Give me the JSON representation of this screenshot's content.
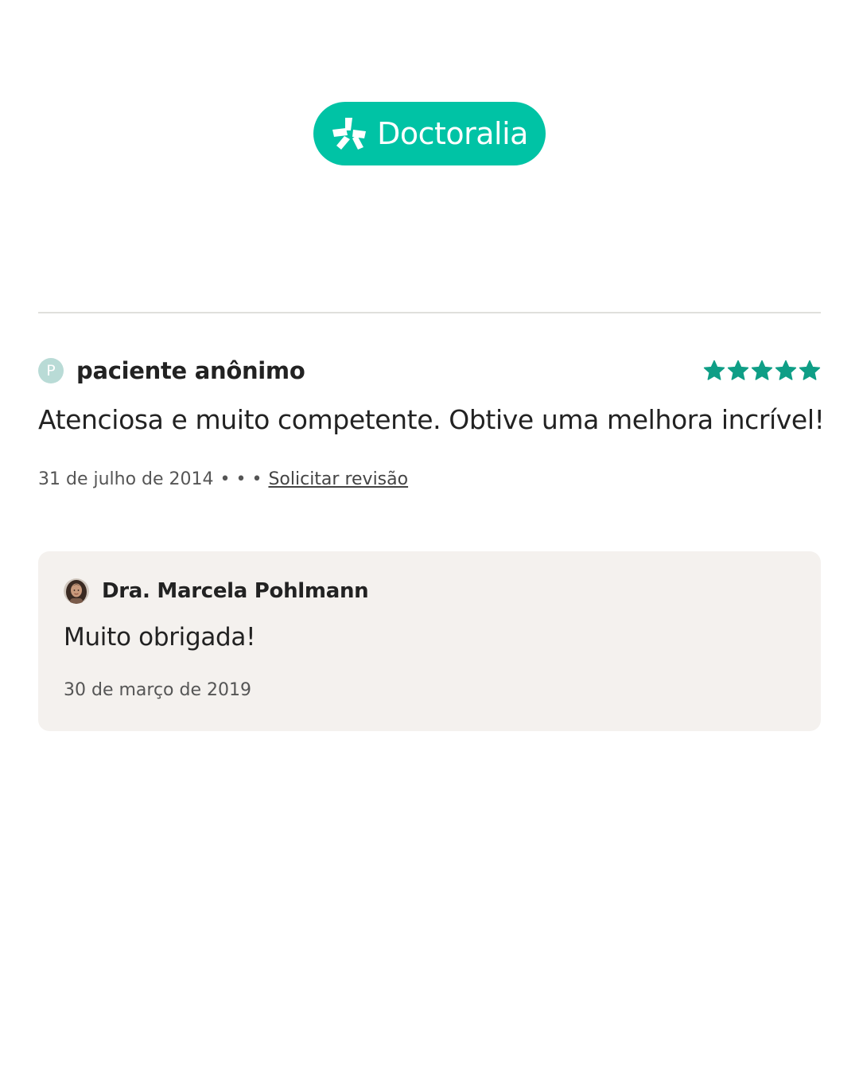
{
  "brand": {
    "name": "Doctoralia",
    "color": "#00c3a5",
    "logo_icon": "doctoralia-star-icon"
  },
  "review": {
    "author_initial": "P",
    "author_name": "paciente anônimo",
    "rating": 5,
    "rating_max": 5,
    "star_color": "#0f9e86",
    "text": "Atenciosa e muito competente. Obtive uma melhora incrível!",
    "date": "31 de julho de 2014",
    "separator": "• • •",
    "report_label": "Solicitar revisão"
  },
  "reply": {
    "author_name": "Dra. Marcela Pohlmann",
    "avatar_icon": "doctor-avatar",
    "text": "Muito obrigada!",
    "date": "30 de março de 2019",
    "background": "#f4f1ee"
  }
}
